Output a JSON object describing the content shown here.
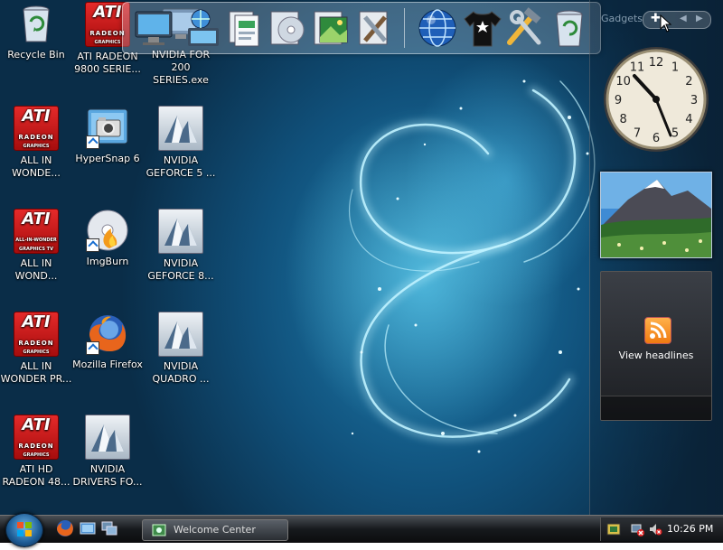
{
  "desktop": {
    "icons": [
      {
        "id": "recycle",
        "label": "Recycle Bin",
        "icon": "recycle-bin-icon"
      },
      {
        "id": "ati9800",
        "label": "ATI RADEON 9800 SERIE...",
        "icon": "ati-radeon-icon"
      },
      {
        "id": "nv200",
        "label": "NVIDIA FOR 200 SERIES.exe",
        "icon": "nvidia-setup-icon"
      },
      {
        "id": "aiw1",
        "label": "ALL IN WONDE...",
        "icon": "ati-radeon-icon"
      },
      {
        "id": "hypersnap",
        "label": "HyperSnap 6",
        "icon": "camera-icon"
      },
      {
        "id": "nvgf5",
        "label": "NVIDIA GEFORCE 5 ...",
        "icon": "nvidia-driver-icon"
      },
      {
        "id": "aiw2",
        "label": "ALL IN WOND...",
        "icon": "ati-all-in-wonder-icon"
      },
      {
        "id": "imgburn",
        "label": "ImgBurn",
        "icon": "disc-flame-icon"
      },
      {
        "id": "nvgf8",
        "label": "NVIDIA GEFORCE 8...",
        "icon": "nvidia-driver-icon"
      },
      {
        "id": "aiwpr",
        "label": "ALL IN WONDER PR...",
        "icon": "ati-radeon-icon"
      },
      {
        "id": "firefox",
        "label": "Mozilla Firefox",
        "icon": "firefox-icon"
      },
      {
        "id": "quadro",
        "label": "NVIDIA QUADRO ...",
        "icon": "nvidia-driver-icon"
      },
      {
        "id": "atihd",
        "label": "ATI HD RADEON 48...",
        "icon": "ati-radeon-icon"
      },
      {
        "id": "nvdrivers",
        "label": "NVIDIA DRIVERS FO...",
        "icon": "nvidia-driver-icon"
      }
    ],
    "ati_logo": {
      "brand": "ATI",
      "line1": "RADEON",
      "line2": "GRAPHICS",
      "aiw_line1": "ALL-IN-WONDER",
      "aiw_line2": "GRAPHICS TV"
    }
  },
  "quick_launch": {
    "items": [
      {
        "icon": "computer-monitor-icon"
      },
      {
        "icon": "network-monitor-icon"
      },
      {
        "icon": "documents-icon"
      },
      {
        "icon": "cd-music-icon"
      },
      {
        "icon": "pictures-icon"
      },
      {
        "icon": "tools-icon"
      },
      {
        "icon": "globe-icon"
      },
      {
        "icon": "tshirt-icon"
      },
      {
        "icon": "hammer-wrench-icon"
      },
      {
        "icon": "recycle-bin-icon"
      }
    ]
  },
  "sidebar": {
    "gadgets_label": "Gadgets",
    "feed_label": "View headlines",
    "clock_numbers": [
      "12",
      "1",
      "2",
      "3",
      "4",
      "5",
      "6",
      "7",
      "8",
      "9",
      "10",
      "11"
    ]
  },
  "taskbar": {
    "window_title": "Welcome Center",
    "time": "10:26 PM"
  },
  "colors": {
    "ati_red": "#d21c1c",
    "accent_blue": "#1f7fb0",
    "taskbar": "#16191d"
  }
}
